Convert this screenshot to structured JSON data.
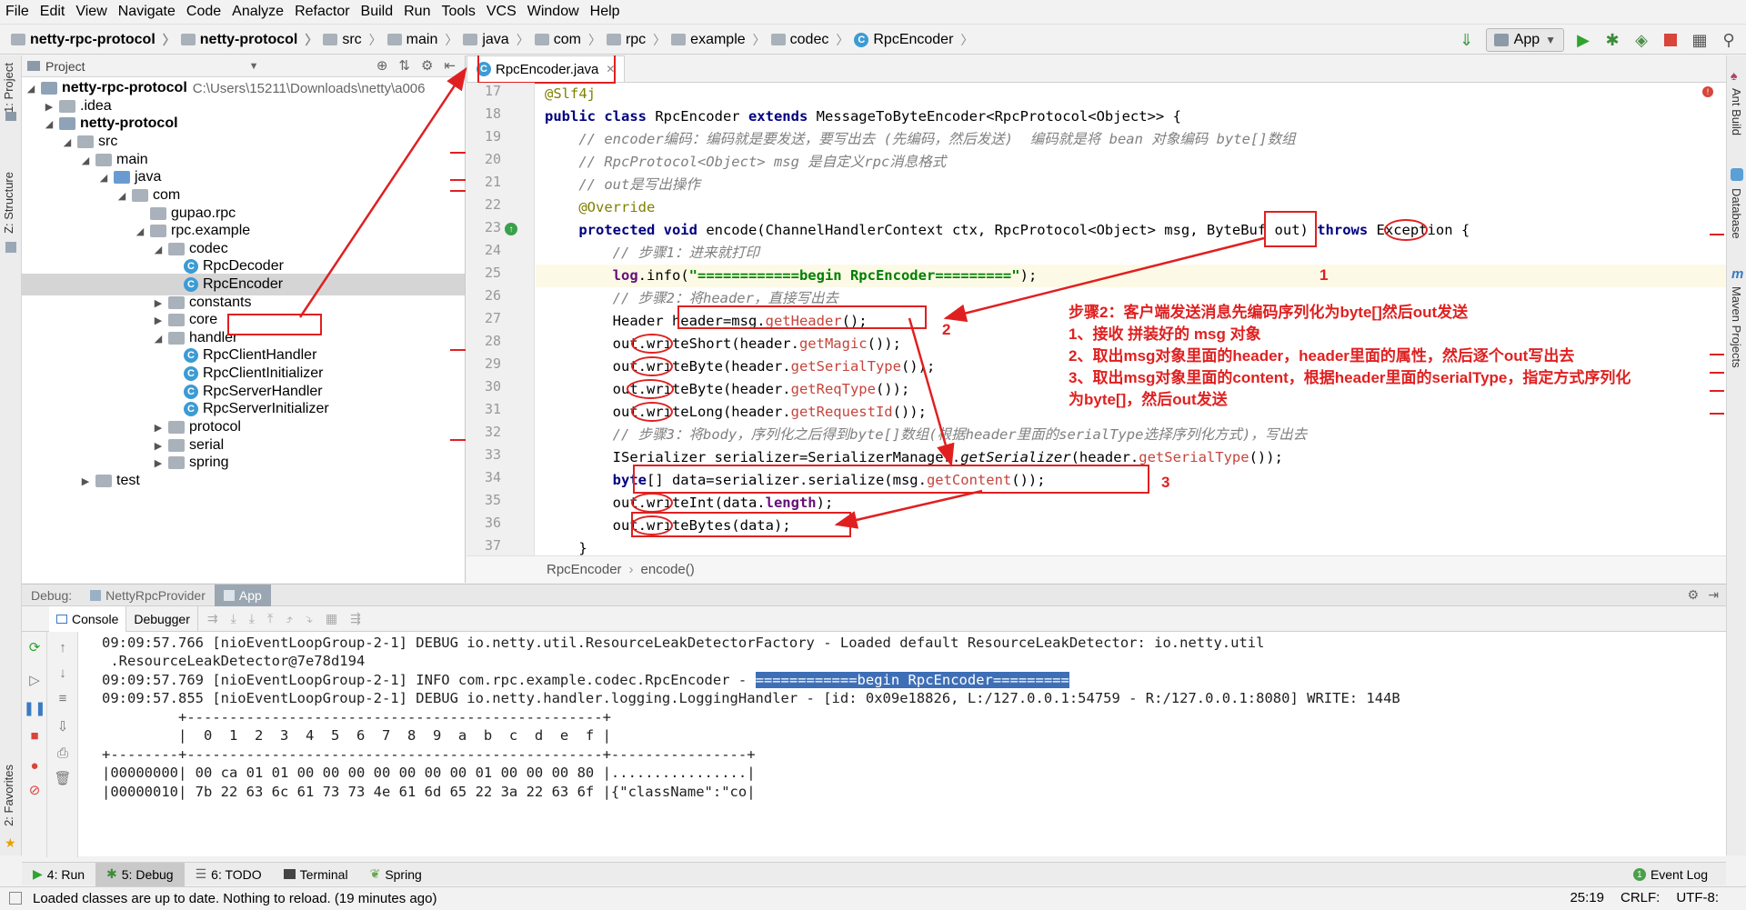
{
  "menu": [
    "File",
    "Edit",
    "View",
    "Navigate",
    "Code",
    "Analyze",
    "Refactor",
    "Build",
    "Run",
    "Tools",
    "VCS",
    "Window",
    "Help"
  ],
  "breadcrumbs": [
    "netty-rpc-protocol",
    "netty-protocol",
    "src",
    "main",
    "java",
    "com",
    "rpc",
    "example",
    "codec",
    "RpcEncoder"
  ],
  "run_config": "App",
  "left_tabs": {
    "project": "1: Project",
    "structure": "Z: Structure",
    "favorites": "2: Favorites"
  },
  "right_tabs": {
    "ant": "Ant Build",
    "database": "Database",
    "maven": "Maven Projects"
  },
  "project_panel": {
    "title": "Project",
    "tree": [
      {
        "label": "netty-rpc-protocol",
        "path": "C:\\Users\\15211\\Downloads\\netty\\a006"
      },
      {
        "label": ".idea"
      },
      {
        "label": "netty-protocol"
      },
      {
        "label": "src"
      },
      {
        "label": "main"
      },
      {
        "label": "java"
      },
      {
        "label": "com"
      },
      {
        "label": "gupao.rpc"
      },
      {
        "label": "rpc.example"
      },
      {
        "label": "codec"
      },
      {
        "label": "RpcDecoder"
      },
      {
        "label": "RpcEncoder"
      },
      {
        "label": "constants"
      },
      {
        "label": "core"
      },
      {
        "label": "handler"
      },
      {
        "label": "RpcClientHandler"
      },
      {
        "label": "RpcClientInitializer"
      },
      {
        "label": "RpcServerHandler"
      },
      {
        "label": "RpcServerInitializer"
      },
      {
        "label": "protocol"
      },
      {
        "label": "serial"
      },
      {
        "label": "spring"
      },
      {
        "label": "test"
      }
    ]
  },
  "editor": {
    "tab": "RpcEncoder.java",
    "line_numbers": [
      "17",
      "18",
      "19",
      "20",
      "21",
      "22",
      "23",
      "24",
      "25",
      "26",
      "27",
      "28",
      "29",
      "30",
      "31",
      "32",
      "33",
      "34",
      "35",
      "36",
      "37"
    ],
    "bottom_breadcrumb": {
      "cls": "RpcEncoder",
      "method": "encode()"
    }
  },
  "annotations": {
    "n1": "1",
    "n2": "2",
    "n3": "3",
    "step_title": "步骤2：客户端发送消息先编码序列化为byte[]然后out发送",
    "step_1": "1、接收 拼装好的 msg 对象",
    "step_2": "2、取出msg对象里面的header，header里面的属性，然后逐个out写出去",
    "step_3a": "3、取出msg对象里面的content，根据header里面的serialType，指定方式序列化",
    "step_3b": "为byte[]，然后out发送"
  },
  "debug": {
    "label": "Debug:",
    "sessions": [
      "NettyRpcProvider",
      "App"
    ],
    "tabs": [
      "Console",
      "Debugger"
    ],
    "console_lines": [
      "09:09:57.766 [nioEventLoopGroup-2-1] DEBUG io.netty.util.ResourceLeakDetectorFactory - Loaded default ResourceLeakDetector: io.netty.util",
      " .ResourceLeakDetector@7e78d194",
      "09:09:57.769 [nioEventLoopGroup-2-1] INFO com.rpc.example.codec.RpcEncoder - ",
      "09:09:57.855 [nioEventLoopGroup-2-1] DEBUG io.netty.handler.logging.LoggingHandler - [id: 0x09e18826, L:/127.0.0.1:54759 - R:/127.0.0.1:8080] WRITE: 144B",
      "         +-------------------------------------------------+",
      "         |  0  1  2  3  4  5  6  7  8  9  a  b  c  d  e  f |",
      "+--------+-------------------------------------------------+----------------+",
      "|00000000| 00 ca 01 01 00 00 00 00 00 00 00 01 00 00 00 80 |................|",
      "|00000010| 7b 22 63 6c 61 73 73 4e 61 6d 65 22 3a 22 63 6f |{\"className\":\"co|"
    ],
    "selected_text": "============begin RpcEncoder========="
  },
  "bottom_tabs": [
    "4: Run",
    "5: Debug",
    "6: TODO",
    "Terminal",
    "Spring"
  ],
  "event_log": "Event Log",
  "status": {
    "message": "Loaded classes are up to date. Nothing to reload. (19 minutes ago)",
    "position": "25:19",
    "line_sep": "CRLF:",
    "encoding": "UTF-8:"
  },
  "colors": {
    "annotation": "#e02020",
    "selection": "#3e6fb6",
    "keyword": "#000080",
    "comment": "#808080",
    "string": "#008000"
  }
}
